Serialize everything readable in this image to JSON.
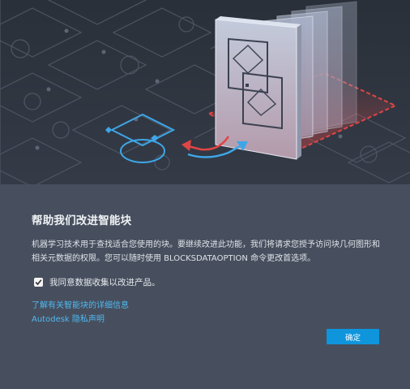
{
  "dialog": {
    "title": "帮助我们改进智能块",
    "description": "机器学习技术用于查找适合您使用的块。要继续改进此功能，我们将请求您授予访问块几何图形和相关元数据的权限。您可以随时使用 BLOCKSDATAOPTION 命令更改首选项。",
    "consent": {
      "checked": true,
      "label": "我同意数据收集以改进产品。"
    },
    "links": [
      {
        "label": "了解有关智能块的详细信息"
      },
      {
        "label": "Autodesk 隐私声明"
      }
    ],
    "ok_button": "确定"
  },
  "colors": {
    "hero_background": "#2c323d",
    "body_background": "#474f5e",
    "accent_blue": "#0e95dc",
    "link_blue": "#4fb8f0",
    "highlight_red": "#e04545"
  },
  "illustration": {
    "icons": [
      "grid-pattern-icon",
      "stacked-block-panels-icon",
      "diamond-circle-shape-icon",
      "red-arrow-icon",
      "blue-arrow-icon"
    ]
  }
}
